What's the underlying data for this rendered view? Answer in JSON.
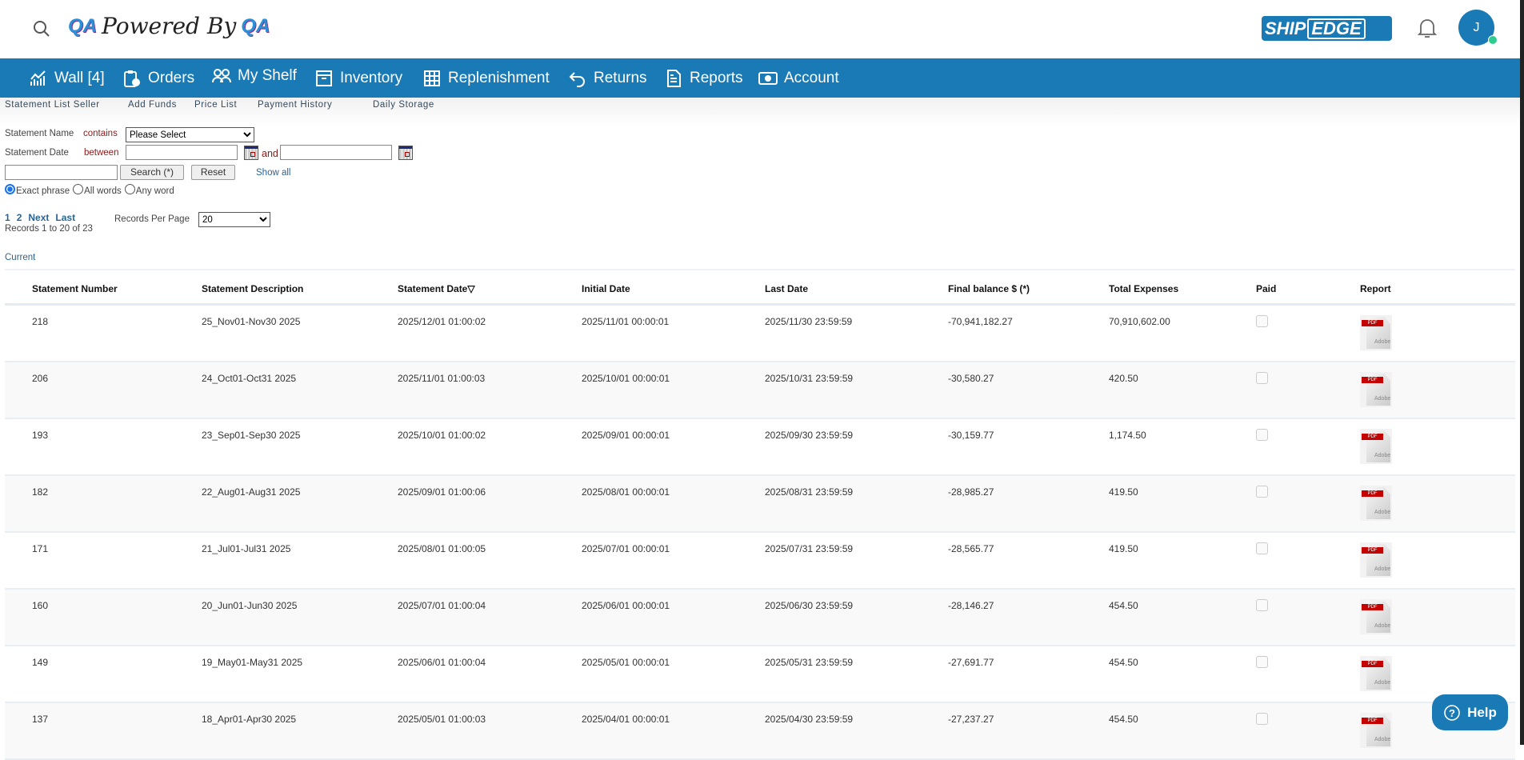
{
  "header": {
    "logo_text": "QA Powered By QA",
    "brand": "SHIPEDGE",
    "brand_left": "SHIP",
    "brand_right": "EDGE",
    "avatar_initial": "J",
    "accent": "#1a7ab5"
  },
  "nav": [
    {
      "label": "Wall [4]",
      "icon": "chart-icon"
    },
    {
      "label": "Orders",
      "icon": "clipboard-clock-icon"
    },
    {
      "label": "My Shelf",
      "icon": "users-icon"
    },
    {
      "label": "Inventory",
      "icon": "archive-icon"
    },
    {
      "label": "Replenishment",
      "icon": "grid-icon"
    },
    {
      "label": "Returns",
      "icon": "undo-icon"
    },
    {
      "label": "Reports",
      "icon": "document-icon"
    },
    {
      "label": "Account",
      "icon": "money-icon"
    }
  ],
  "subnav": [
    "Statement List Seller",
    "Add Funds",
    "Price List",
    "Payment History",
    "Daily Storage"
  ],
  "filters": {
    "name_label": "Statement Name",
    "contains": "contains",
    "name_select": "Please Select",
    "date_label": "Statement Date",
    "between": "between",
    "and": "and",
    "search_value": "",
    "search_btn": "Search (*)",
    "reset_btn": "Reset",
    "show_all": "Show all",
    "radios": [
      {
        "label": "Exact phrase",
        "checked": true
      },
      {
        "label": "All words",
        "checked": false
      },
      {
        "label": "Any word",
        "checked": false
      }
    ]
  },
  "pagination": {
    "p1": "1",
    "p2": "2",
    "next": "Next",
    "last": "Last",
    "records": "Records 1 to 20 of 23",
    "per_page_label": "Records Per Page",
    "per_page": "20"
  },
  "section": "Current",
  "table": {
    "headers": [
      "Statement Number",
      "Statement Description",
      "Statement Date▽",
      "Initial Date",
      "Last Date",
      "Final balance $ (*)",
      "Total Expenses",
      "Paid",
      "Report"
    ],
    "rows": [
      [
        "218",
        "25_Nov01-Nov30 2025",
        "2025/12/01 01:00:02",
        "2025/11/01 00:00:01",
        "2025/11/30 23:59:59",
        "-70,941,182.27",
        "70,910,602.00"
      ],
      [
        "206",
        "24_Oct01-Oct31 2025",
        "2025/11/01 01:00:03",
        "2025/10/01 00:00:01",
        "2025/10/31 23:59:59",
        "-30,580.27",
        "420.50"
      ],
      [
        "193",
        "23_Sep01-Sep30 2025",
        "2025/10/01 01:00:02",
        "2025/09/01 00:00:01",
        "2025/09/30 23:59:59",
        "-30,159.77",
        "1,174.50"
      ],
      [
        "182",
        "22_Aug01-Aug31 2025",
        "2025/09/01 01:00:06",
        "2025/08/01 00:00:01",
        "2025/08/31 23:59:59",
        "-28,985.27",
        "419.50"
      ],
      [
        "171",
        "21_Jul01-Jul31 2025",
        "2025/08/01 01:00:05",
        "2025/07/01 00:00:01",
        "2025/07/31 23:59:59",
        "-28,565.77",
        "419.50"
      ],
      [
        "160",
        "20_Jun01-Jun30 2025",
        "2025/07/01 01:00:04",
        "2025/06/01 00:00:01",
        "2025/06/30 23:59:59",
        "-28,146.27",
        "454.50"
      ],
      [
        "149",
        "19_May01-May31 2025",
        "2025/06/01 01:00:04",
        "2025/05/01 00:00:01",
        "2025/05/31 23:59:59",
        "-27,691.77",
        "454.50"
      ],
      [
        "137",
        "18_Apr01-Apr30 2025",
        "2025/05/01 01:00:03",
        "2025/04/01 00:00:01",
        "2025/04/30 23:59:59",
        "-27,237.27",
        "454.50"
      ]
    ]
  },
  "pdf_tag": "PDF",
  "pdf_brand": "Adobe",
  "help": "Help"
}
